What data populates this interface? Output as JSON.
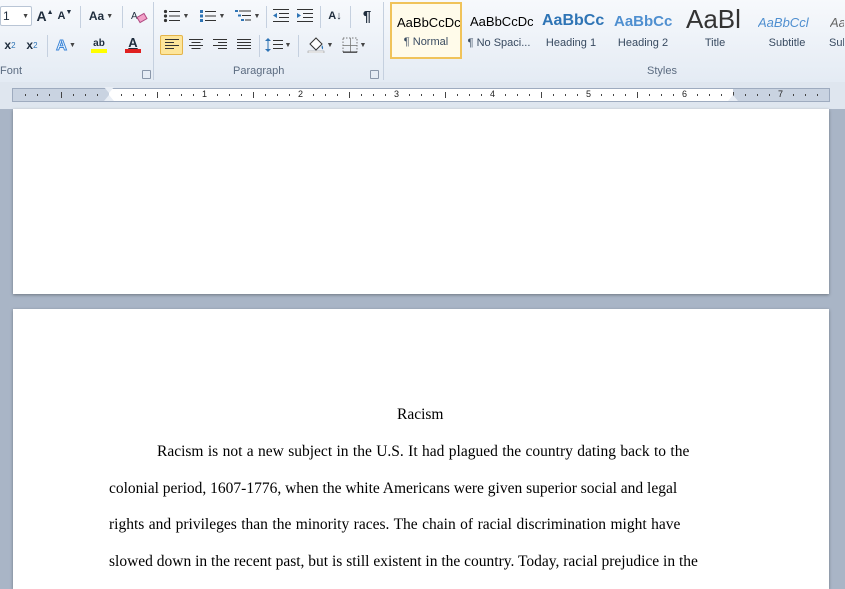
{
  "ribbon": {
    "font_group_label": "Font",
    "paragraph_group_label": "Paragraph",
    "styles_group_label": "Styles",
    "font_size_value": "1",
    "grow_font_label": "A",
    "shrink_font_label": "A",
    "change_case_label": "Aa",
    "subscript_label": "x",
    "subscript_sub": "2",
    "superscript_label": "x",
    "superscript_sup": "2",
    "text_effects_label": "A",
    "highlight_label": "ab",
    "font_color_label": "A",
    "pilcrow_label": "¶",
    "sort_label": "A↓",
    "colors": {
      "accent_selected": "#fde59a",
      "highlight_yellow": "#ffff00",
      "font_color_red": "#e02020",
      "text_effects_blue": "#3c86d8",
      "heading_blue": "#2e74b5"
    }
  },
  "styles": [
    {
      "sample": "AaBbCcDc",
      "name": "¶ Normal",
      "selected": true
    },
    {
      "sample": "AaBbCcDc",
      "name": "¶ No Spaci...",
      "selected": false
    },
    {
      "sample": "AaBbCc",
      "name": "Heading 1",
      "selected": false
    },
    {
      "sample": "AaBbCc",
      "name": "Heading 2",
      "selected": false
    },
    {
      "sample": "AaBl",
      "name": "Title",
      "selected": false
    },
    {
      "sample": "AaBbCcl",
      "name": "Subtitle",
      "selected": false
    },
    {
      "sample": "Aa",
      "name": "Sub",
      "selected": false
    }
  ],
  "ruler": {
    "numbers": [
      "1",
      "2",
      "3",
      "4",
      "5",
      "6",
      "7"
    ]
  },
  "document": {
    "title": "Racism",
    "lines": [
      "Racism is not a new subject in the U.S. It had plagued the country dating back to the",
      "colonial period, 1607-1776, when the white Americans were given superior social and legal",
      "rights and privileges than the minority races. The chain of racial discrimination might have",
      "slowed down in the recent past, but is still existent in the country. Today, racial prejudice in the"
    ]
  }
}
